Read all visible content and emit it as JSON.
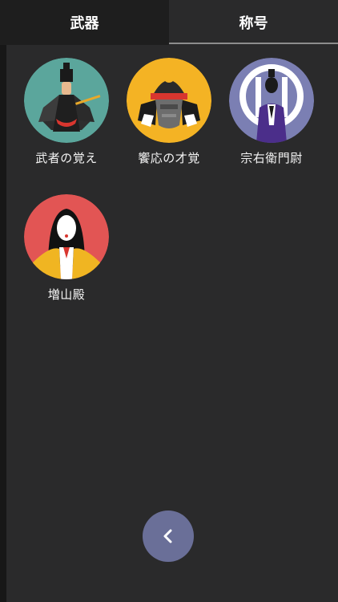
{
  "tabs": [
    {
      "label": "武器",
      "active": true
    },
    {
      "label": "称号",
      "active": false
    }
  ],
  "items": [
    {
      "label": "武者の覚え",
      "icon": "samurai-courtier-icon",
      "bg": "#5ba69c"
    },
    {
      "label": "饗応の才覚",
      "icon": "samurai-armor-icon",
      "bg": "#f4b324"
    },
    {
      "label": "宗右衛門尉",
      "icon": "samurai-crest-icon",
      "bg": "#7b7fb3"
    },
    {
      "label": "増山殿",
      "icon": "court-lady-icon",
      "bg": "#e25554"
    }
  ],
  "back_button": {
    "icon": "chevron-left-icon",
    "color": "#6a6f98"
  }
}
